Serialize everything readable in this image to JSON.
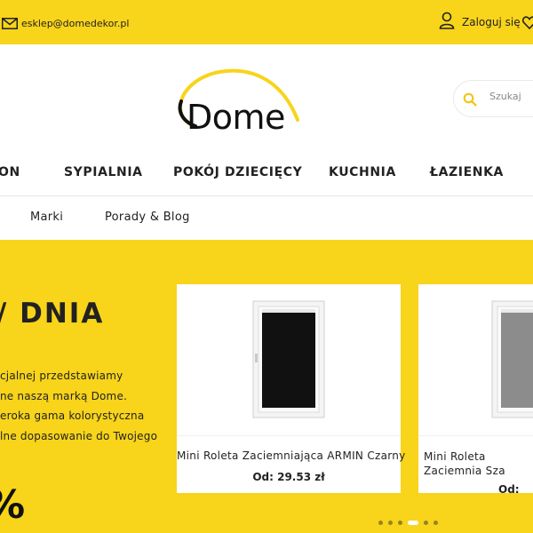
{
  "topbar": {
    "email": "esklep@domedekor.pl",
    "login_label": "Zaloguj się"
  },
  "header": {
    "logo_text": "Dome",
    "search_placeholder": "Szukaj"
  },
  "nav": {
    "items": [
      "ON",
      "SYPIALNIA",
      "POKÓJ DZIECIĘCY",
      "KUCHNIA",
      "ŁAZIENKA"
    ]
  },
  "subnav": {
    "items": [
      "Marki",
      "Porady & Blog"
    ]
  },
  "promo": {
    "title": "/ DNIA",
    "lines": [
      "cjalnej przedstawiamy",
      "ne naszą marką Dome.",
      "eroka gama kolorystyczna",
      "lne dopasowanie do Twojego"
    ],
    "percent": "%"
  },
  "products": [
    {
      "name": "Mini Roleta Zaciemniająca ARMIN Czarny",
      "price": "Od: 29.53 zł"
    },
    {
      "name": "Mini Roleta Zaciemnia Sza",
      "price": "Od:"
    }
  ],
  "carousel": {
    "slide_count": 6,
    "active_index": 3
  },
  "colors": {
    "brand_yellow": "#f8d41a",
    "text_dark": "#222222"
  }
}
